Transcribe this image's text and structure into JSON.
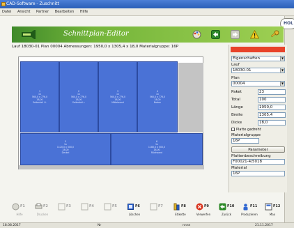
{
  "window": {
    "title": "CAD-Software - Zuschnitt"
  },
  "menu": [
    "Datei",
    "Ansicht",
    "Partner",
    "Bearbeiten",
    "Hilfe"
  ],
  "hol_label": "HOL",
  "banner": {
    "title": "Schnittplan-Editor"
  },
  "info": {
    "text": "Lauf  18030-01  Plan  00004  Abmessungen: 1950,0 x 1305,4 x 18,0   Materialgruppe: 16P"
  },
  "pieces": [
    {
      "pos": "1",
      "qty": "1x",
      "line1": "560,0 x 776,0",
      "line2": "18,00",
      "line3": "Seitenteil l.i."
    },
    {
      "pos": "2",
      "qty": "1x",
      "line1": "560,0 x 776,0",
      "line2": "18,00",
      "line3": "Seitenteil r."
    },
    {
      "pos": "3",
      "qty": "1x",
      "line1": "560,0 x 776,0",
      "line2": "18,00",
      "line3": "Mittelwand"
    },
    {
      "pos": "4",
      "qty": "1x",
      "line1": "560,0 x 776,0",
      "line2": "18,00",
      "line3": "Boden"
    },
    {
      "pos": "5",
      "qty": "1x",
      "line1": "1120,0 x 500,0",
      "line2": "18,00",
      "line3": "Deckel"
    },
    {
      "pos": "6",
      "qty": "1x",
      "line1": "1180,0 x 500,0",
      "line2": "18,00",
      "line3": "Rückwand"
    }
  ],
  "panel": {
    "header": "",
    "eigenschaften": "Eigenschaften",
    "lauf_label": "Lauf",
    "lauf_value": "18030-01",
    "plan_label": "Plan",
    "plan_value": "00004",
    "rows": [
      {
        "label": "Paket",
        "value": "23"
      },
      {
        "label": "Total",
        "value": "100"
      },
      {
        "label": "Länge",
        "value": "1950,0"
      },
      {
        "label": "Breite",
        "value": "1305,4"
      },
      {
        "label": "Dicke",
        "value": "18,0"
      }
    ],
    "checkbox_label": "Platte gedreht",
    "materialgruppe_label": "Materialgruppe",
    "materialgruppe_value": "16P",
    "parameter_button": "Parameter",
    "plattenbeschreibung_label": "Plattenbeschreibung",
    "plattenbeschreibung_value": "F00021-4/5018",
    "material_label": "Material",
    "material_value": "16P"
  },
  "fkeys": [
    {
      "key": "F1",
      "label": "Hilfe",
      "enabled": false,
      "icon": "help-icon"
    },
    {
      "key": "F2",
      "label": "Drucken",
      "enabled": false,
      "icon": "print-icon"
    },
    {
      "key": "F3",
      "label": "",
      "enabled": false,
      "icon": "blank-icon"
    },
    {
      "key": "F4",
      "label": "",
      "enabled": false,
      "icon": "blank-icon"
    },
    {
      "key": "F5",
      "label": "",
      "enabled": false,
      "icon": "blank-icon"
    },
    {
      "key": "F6",
      "label": "Löschen",
      "enabled": true,
      "icon": "delete-icon"
    },
    {
      "key": "F7",
      "label": "",
      "enabled": false,
      "icon": "blank-icon"
    },
    {
      "key": "F8",
      "label": "Etikette",
      "enabled": true,
      "icon": "label-icon"
    },
    {
      "key": "F9",
      "label": "Verwerfen",
      "enabled": true,
      "icon": "cancel-icon"
    },
    {
      "key": "F10",
      "label": "Zurück",
      "enabled": true,
      "icon": "back-icon"
    },
    {
      "key": "F11",
      "label": "Produzieren",
      "enabled": true,
      "icon": "produce-icon"
    },
    {
      "key": "F12",
      "label": "Max",
      "enabled": true,
      "icon": "max-icon"
    }
  ],
  "status": {
    "left": "18.08.2017",
    "mid1": "Nr",
    "mid2": "nnnn",
    "right": "21.11.2017"
  },
  "colors": {
    "piece": "#4a72d6",
    "banner": "#74b53a",
    "accent_red": "#e8432a"
  }
}
